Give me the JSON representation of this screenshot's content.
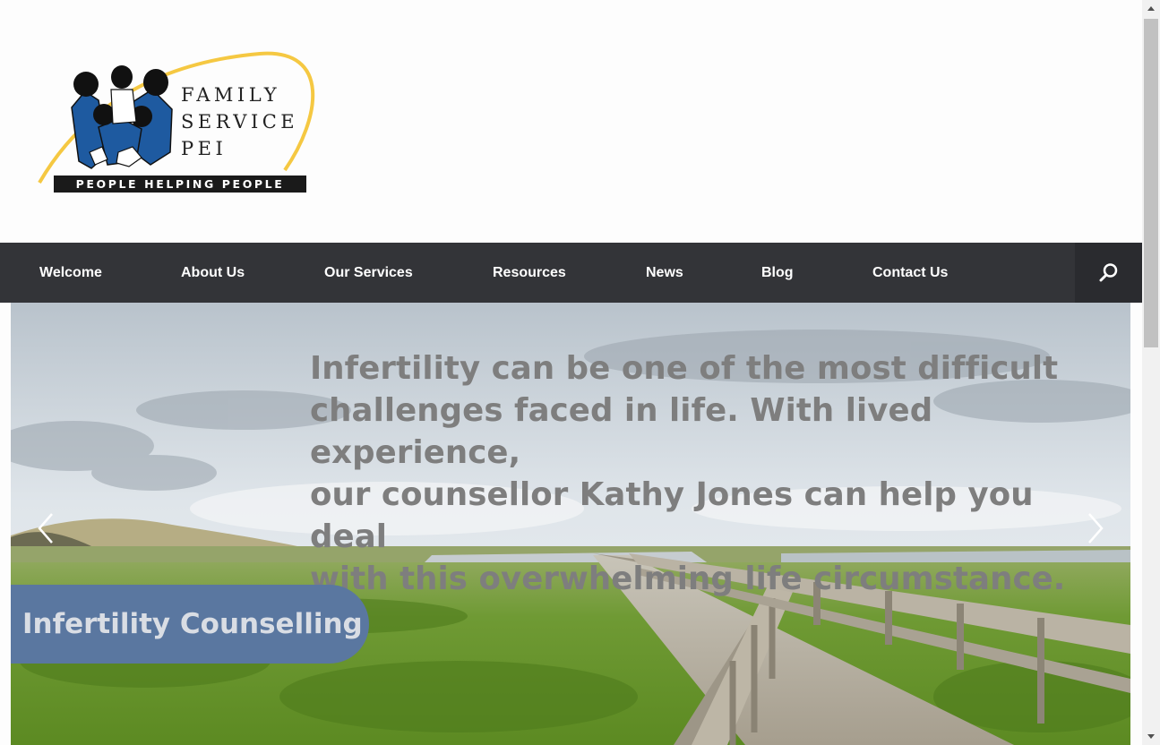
{
  "logo": {
    "line1": "FAMILY",
    "line2": "SERVICE",
    "line3": "PEI",
    "tagline": "PEOPLE HELPING PEOPLE"
  },
  "nav": {
    "items": [
      {
        "label": "Welcome"
      },
      {
        "label": "About Us"
      },
      {
        "label": "Our Services"
      },
      {
        "label": "Resources"
      },
      {
        "label": "News"
      },
      {
        "label": "Blog"
      },
      {
        "label": "Contact Us"
      }
    ],
    "search_icon": "search-icon"
  },
  "hero": {
    "text_lines": [
      "Infertility can be one of the most difficult",
      "challenges faced in life. With lived experience,",
      "our counsellor Kathy Jones can help you deal",
      "with this overwhelming life circumstance."
    ],
    "badge": "Infertility Counselling",
    "prev_icon": "chevron-left-icon",
    "next_icon": "chevron-right-icon"
  },
  "colors": {
    "nav_bg": "#333438",
    "badge_bg": "#5a77a0",
    "logo_blue": "#1e5aa0",
    "logo_yellow": "#f5c842"
  }
}
